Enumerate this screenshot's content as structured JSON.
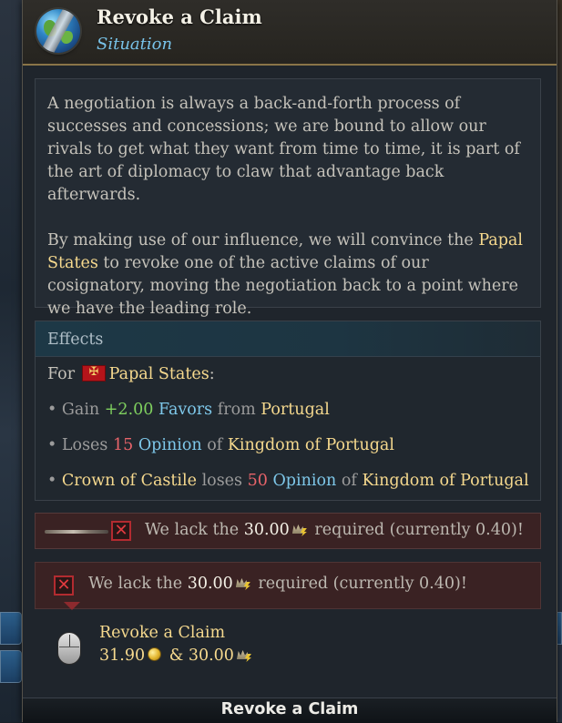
{
  "header": {
    "title": "Revoke a Claim",
    "subtitle": "Situation",
    "icon": "globe-icon"
  },
  "description": {
    "paragraph1": "A negotiation is always a back-and-forth process of successes and concessions; we are bound to allow our rivals to get what they want from time to time, it is part of the art of diplomacy to claw that advantage back afterwards.",
    "p2_before": "By making use of our influence, we will convince the ",
    "p2_highlight": "Papal States",
    "p2_after": " to revoke one of the active claims of our cosignatory, moving the negotiation back to a point where we have the leading role."
  },
  "effects": {
    "header": "Effects",
    "for_prefix": "For",
    "target": "Papal States",
    "target_suffix": ":",
    "line1": {
      "bullet": "•",
      "verb": "Gain",
      "value": "+2.00",
      "resource": "Favors",
      "prep": "from",
      "country": "Portugal"
    },
    "line2": {
      "bullet": "•",
      "verb": "Loses",
      "value": "15",
      "resource": "Opinion",
      "prep": "of",
      "country": "Kingdom of Portugal"
    },
    "line3": {
      "bullet": "•",
      "subject": "Crown of Castile",
      "verb": "loses",
      "value": "50",
      "resource": "Opinion",
      "prep": "of",
      "country": "Kingdom of Portugal"
    }
  },
  "requirements": {
    "req1": {
      "prefix": "We lack the",
      "amount": "30.00",
      "suffix": "required (currently 0.40)!"
    },
    "req2": {
      "prefix": "We lack the",
      "amount": "30.00",
      "suffix": "required (currently 0.40)!"
    }
  },
  "action": {
    "title": "Revoke a Claim",
    "cost_gold": "31.90",
    "cost_sep": "&",
    "cost_influence": "30.00"
  },
  "footer": {
    "label": "Revoke a Claim"
  },
  "colors": {
    "highlight": "#f6d98e",
    "positive": "#7fd05f",
    "negative": "#e8646a",
    "resource": "#7ec8ea",
    "subtitle": "#78c2e8"
  }
}
